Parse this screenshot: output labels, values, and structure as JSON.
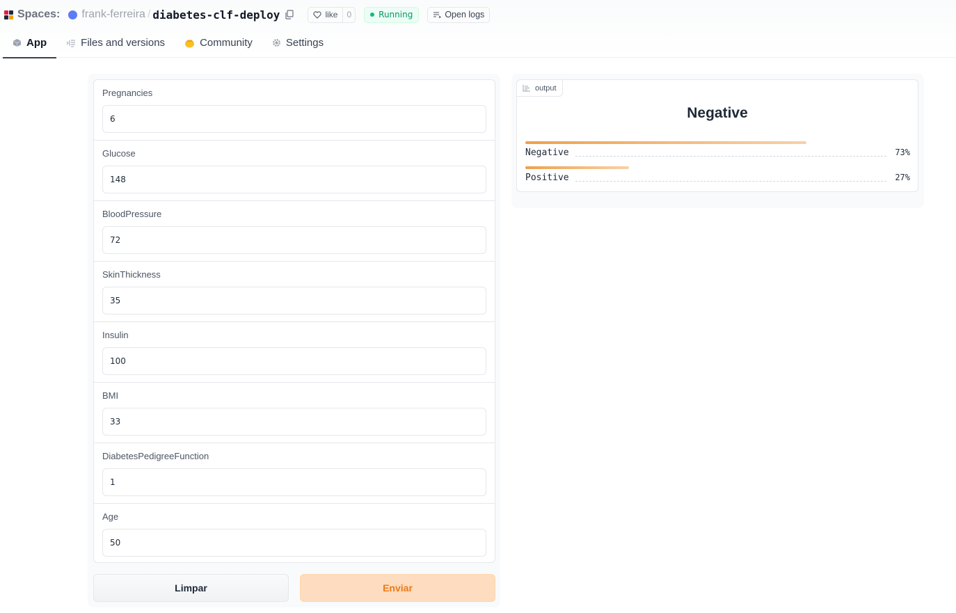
{
  "header": {
    "spaces_label": "Spaces:",
    "owner": "frank-ferreira",
    "separator": "/",
    "repo": "diabetes-clf-deploy",
    "like_label": "like",
    "like_count": "0",
    "status": "Running",
    "logs_label": "Open logs",
    "owner_color": "#5b7cf6",
    "status_color": "#10b981"
  },
  "tabs": [
    {
      "label": "App",
      "icon": "cube-icon",
      "active": true
    },
    {
      "label": "Files and versions",
      "icon": "files-icon",
      "active": false
    },
    {
      "label": "Community",
      "icon": "community-icon",
      "active": false
    },
    {
      "label": "Settings",
      "icon": "gear-icon",
      "active": false
    }
  ],
  "form": {
    "fields": [
      {
        "label": "Pregnancies",
        "value": "6"
      },
      {
        "label": "Glucose",
        "value": "148"
      },
      {
        "label": "BloodPressure",
        "value": "72"
      },
      {
        "label": "SkinThickness",
        "value": "35"
      },
      {
        "label": "Insulin",
        "value": "100"
      },
      {
        "label": "BMI",
        "value": "33"
      },
      {
        "label": "DiabetesPedigreeFunction",
        "value": "1"
      },
      {
        "label": "Age",
        "value": "50"
      }
    ],
    "clear_label": "Limpar",
    "submit_label": "Enviar",
    "accent_color": "#ea7a19"
  },
  "output": {
    "tag": "output",
    "label": "Negative",
    "confidences": [
      {
        "label": "Negative",
        "value": 0.73,
        "display": "73%"
      },
      {
        "label": "Positive",
        "value": 0.27,
        "display": "27%"
      }
    ]
  }
}
